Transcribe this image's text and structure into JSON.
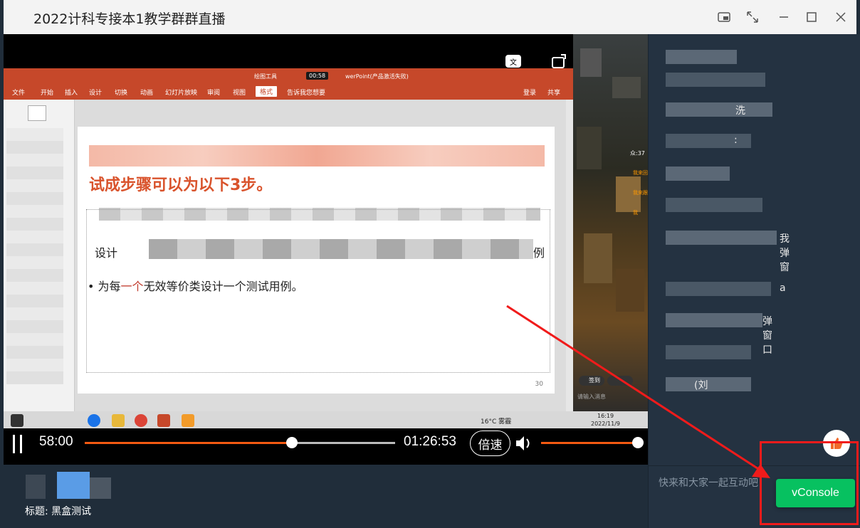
{
  "window": {
    "title": "2022计科专接本1教学群群直播"
  },
  "ppt": {
    "tabs": [
      "文件",
      "开始",
      "插入",
      "设计",
      "切换",
      "动画",
      "幻灯片放映",
      "审阅",
      "视图",
      "格式"
    ],
    "active_tab": "格式",
    "drawing_tools": "绘图工具",
    "tell_me": "告诉我您想要",
    "login": "登录",
    "share": "共享",
    "doc_title_suffix": "werPoint(产品激活失败)",
    "rec_time": "00:58",
    "slide_title": "试成步骤可以为以下3步。",
    "bullet_prefix": "为每",
    "bullet_hl": "一个",
    "bullet_rest": "无效等价类设计一个测试用例。",
    "line2_prefix": "设计",
    "line2_suffix": "例",
    "page_number": "30",
    "weather": "16°C 雾霾",
    "clock_time": "16:19",
    "clock_date": "2022/11/9",
    "right_badge_text": "众:37",
    "right_items": [
      "我来回",
      "我来跟",
      "我"
    ],
    "sign_in": "签到",
    "comment_placeholder": "请输入消息"
  },
  "player": {
    "current_time": "58:00",
    "total_time": "01:26:53",
    "progress_percent": 66.7,
    "speed_label": "倍速",
    "volume_percent": 100
  },
  "info": {
    "title_label": "标题: 黑盒测试"
  },
  "chat": {
    "rows": [
      {
        "text": ""
      },
      {
        "text": ""
      },
      {
        "text": "洗"
      },
      {
        "text": ":"
      },
      {
        "text": ""
      },
      {
        "text": ""
      },
      {
        "text": "我  弹窗"
      },
      {
        "text": "a"
      },
      {
        "text": "弹窗口"
      },
      {
        "text": ""
      },
      {
        "text": "(刘"
      }
    ],
    "input_placeholder": "快来和大家一起互动吧"
  },
  "vconsole": {
    "label": "vConsole",
    "color": "#07c160"
  },
  "colors": {
    "accent": "#f45a12",
    "annotation": "#f01b1b",
    "ppt_brand": "#c6482a"
  }
}
